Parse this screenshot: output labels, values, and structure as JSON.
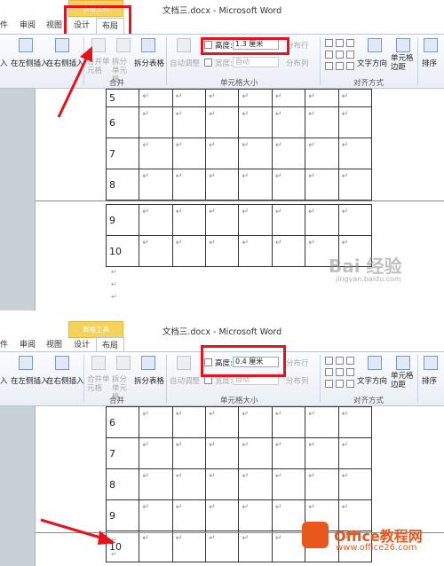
{
  "top": {
    "window_title": "文档三.docx - Microsoft Word",
    "context_tab": "表格工具",
    "tabs": [
      "件",
      "审阅",
      "视图",
      "设计",
      "布局"
    ],
    "ribbon": {
      "insert_left_partial": "入",
      "insert_left": "在左侧插入",
      "insert_right": "在右侧插入",
      "merge_cells": "合并单元格",
      "split_cells": "拆分单元格",
      "split_table": "拆分表格",
      "autofit": "自动调整",
      "height_label": "高度:",
      "height_value": "1.3 厘米",
      "width_label": "宽度:",
      "width_value": "自动",
      "distribute_rows": "分布行",
      "distribute_cols": "分布列",
      "text_direction": "文字方向",
      "cell_margins": "单元格边距",
      "sort": "排序",
      "group_merge": "合并",
      "group_cell_size": "单元格大小",
      "group_alignment": "对齐方式"
    },
    "table_rows": [
      "5",
      "6",
      "7",
      "8",
      "9",
      "10"
    ],
    "cell_mark": "↵",
    "watermark": "Bai 经验",
    "watermark_sub": "jingyan.baidu.com"
  },
  "bottom": {
    "window_title": "文档三.docx - Microsoft Word",
    "context_tab": "表格工具",
    "tabs": [
      "件",
      "审阅",
      "视图",
      "设计",
      "布局"
    ],
    "ribbon": {
      "insert_left_partial": "入",
      "insert_left": "在左侧插入",
      "insert_right": "在右侧插入",
      "merge_cells": "合并单元格",
      "split_cells": "拆分单元格",
      "split_table": "拆分表格",
      "autofit": "自动调整",
      "height_label": "高度:",
      "height_value": "0.4 厘米",
      "width_label": "宽度:",
      "width_value": "自动",
      "distribute_rows": "分布行",
      "distribute_cols": "分布列",
      "text_direction": "文字方向",
      "cell_margins": "单元格边距",
      "sort": "排序",
      "group_merge": "合并",
      "group_cell_size": "单元格大小",
      "group_alignment": "对齐方式"
    },
    "table_rows": [
      "6",
      "7",
      "8",
      "9",
      "10"
    ],
    "cell_mark": "↵",
    "watermark_brand": "Office教程网",
    "watermark_url": "www.office26.com"
  },
  "colors": {
    "highlight": "#e4141e",
    "context_tab": "#f4d35b",
    "office_orange": "#e8571b"
  }
}
